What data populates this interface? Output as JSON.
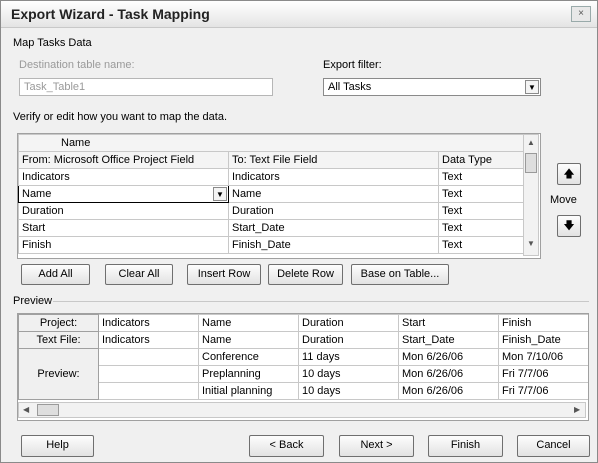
{
  "window": {
    "title": "Export Wizard - Task Mapping",
    "close_glyph": "×"
  },
  "section_title": "Map Tasks Data",
  "destination": {
    "label": "Destination table name:",
    "value": "Task_Table1"
  },
  "export_filter": {
    "label": "Export filter:",
    "value": "All Tasks"
  },
  "verify_label": "Verify or edit how you want to map the data.",
  "mapping": {
    "top_header": "Name",
    "headers": [
      "From: Microsoft Office Project Field",
      "To: Text File Field",
      "Data Type"
    ],
    "rows": [
      [
        "Indicators",
        "Indicators",
        "Text"
      ],
      [
        "Name",
        "Name",
        "Text"
      ],
      [
        "Duration",
        "Duration",
        "Text"
      ],
      [
        "Start",
        "Start_Date",
        "Text"
      ],
      [
        "Finish",
        "Finish_Date",
        "Text"
      ]
    ]
  },
  "move_label": "Move",
  "buttons": {
    "add_all": "Add All",
    "clear_all": "Clear All",
    "insert_row": "Insert Row",
    "delete_row": "Delete Row",
    "base_on_table": "Base on Table..."
  },
  "preview": {
    "label": "Preview",
    "row_headers": [
      "Project:",
      "Text File:",
      "Preview:"
    ],
    "project": [
      "Indicators",
      "Name",
      "Duration",
      "Start",
      "Finish"
    ],
    "textfile": [
      "Indicators",
      "Name",
      "Duration",
      "Start_Date",
      "Finish_Date"
    ],
    "data": [
      [
        "",
        "Conference",
        "11 days",
        "Mon 6/26/06",
        "Mon 7/10/06"
      ],
      [
        "",
        "Preplanning",
        "10 days",
        "Mon 6/26/06",
        "Fri 7/7/06"
      ],
      [
        "",
        "Initial planning",
        "10 days",
        "Mon 6/26/06",
        "Fri 7/7/06"
      ]
    ]
  },
  "footer": {
    "help": "Help",
    "back": "< Back",
    "next": "Next >",
    "finish": "Finish",
    "cancel": "Cancel"
  }
}
